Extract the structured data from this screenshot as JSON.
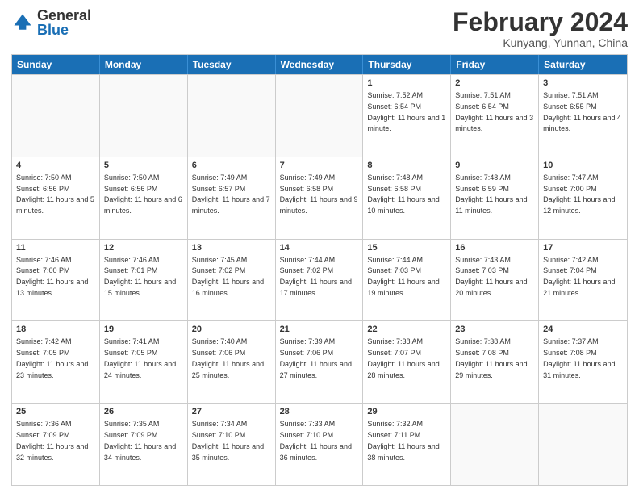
{
  "logo": {
    "general": "General",
    "blue": "Blue"
  },
  "title": "February 2024",
  "location": "Kunyang, Yunnan, China",
  "header_days": [
    "Sunday",
    "Monday",
    "Tuesday",
    "Wednesday",
    "Thursday",
    "Friday",
    "Saturday"
  ],
  "rows": [
    [
      {
        "day": "",
        "info": "",
        "empty": true
      },
      {
        "day": "",
        "info": "",
        "empty": true
      },
      {
        "day": "",
        "info": "",
        "empty": true
      },
      {
        "day": "",
        "info": "",
        "empty": true
      },
      {
        "day": "1",
        "info": "Sunrise: 7:52 AM\nSunset: 6:54 PM\nDaylight: 11 hours and 1 minute.",
        "empty": false
      },
      {
        "day": "2",
        "info": "Sunrise: 7:51 AM\nSunset: 6:54 PM\nDaylight: 11 hours and 3 minutes.",
        "empty": false
      },
      {
        "day": "3",
        "info": "Sunrise: 7:51 AM\nSunset: 6:55 PM\nDaylight: 11 hours and 4 minutes.",
        "empty": false
      }
    ],
    [
      {
        "day": "4",
        "info": "Sunrise: 7:50 AM\nSunset: 6:56 PM\nDaylight: 11 hours and 5 minutes.",
        "empty": false
      },
      {
        "day": "5",
        "info": "Sunrise: 7:50 AM\nSunset: 6:56 PM\nDaylight: 11 hours and 6 minutes.",
        "empty": false
      },
      {
        "day": "6",
        "info": "Sunrise: 7:49 AM\nSunset: 6:57 PM\nDaylight: 11 hours and 7 minutes.",
        "empty": false
      },
      {
        "day": "7",
        "info": "Sunrise: 7:49 AM\nSunset: 6:58 PM\nDaylight: 11 hours and 9 minutes.",
        "empty": false
      },
      {
        "day": "8",
        "info": "Sunrise: 7:48 AM\nSunset: 6:58 PM\nDaylight: 11 hours and 10 minutes.",
        "empty": false
      },
      {
        "day": "9",
        "info": "Sunrise: 7:48 AM\nSunset: 6:59 PM\nDaylight: 11 hours and 11 minutes.",
        "empty": false
      },
      {
        "day": "10",
        "info": "Sunrise: 7:47 AM\nSunset: 7:00 PM\nDaylight: 11 hours and 12 minutes.",
        "empty": false
      }
    ],
    [
      {
        "day": "11",
        "info": "Sunrise: 7:46 AM\nSunset: 7:00 PM\nDaylight: 11 hours and 13 minutes.",
        "empty": false
      },
      {
        "day": "12",
        "info": "Sunrise: 7:46 AM\nSunset: 7:01 PM\nDaylight: 11 hours and 15 minutes.",
        "empty": false
      },
      {
        "day": "13",
        "info": "Sunrise: 7:45 AM\nSunset: 7:02 PM\nDaylight: 11 hours and 16 minutes.",
        "empty": false
      },
      {
        "day": "14",
        "info": "Sunrise: 7:44 AM\nSunset: 7:02 PM\nDaylight: 11 hours and 17 minutes.",
        "empty": false
      },
      {
        "day": "15",
        "info": "Sunrise: 7:44 AM\nSunset: 7:03 PM\nDaylight: 11 hours and 19 minutes.",
        "empty": false
      },
      {
        "day": "16",
        "info": "Sunrise: 7:43 AM\nSunset: 7:03 PM\nDaylight: 11 hours and 20 minutes.",
        "empty": false
      },
      {
        "day": "17",
        "info": "Sunrise: 7:42 AM\nSunset: 7:04 PM\nDaylight: 11 hours and 21 minutes.",
        "empty": false
      }
    ],
    [
      {
        "day": "18",
        "info": "Sunrise: 7:42 AM\nSunset: 7:05 PM\nDaylight: 11 hours and 23 minutes.",
        "empty": false
      },
      {
        "day": "19",
        "info": "Sunrise: 7:41 AM\nSunset: 7:05 PM\nDaylight: 11 hours and 24 minutes.",
        "empty": false
      },
      {
        "day": "20",
        "info": "Sunrise: 7:40 AM\nSunset: 7:06 PM\nDaylight: 11 hours and 25 minutes.",
        "empty": false
      },
      {
        "day": "21",
        "info": "Sunrise: 7:39 AM\nSunset: 7:06 PM\nDaylight: 11 hours and 27 minutes.",
        "empty": false
      },
      {
        "day": "22",
        "info": "Sunrise: 7:38 AM\nSunset: 7:07 PM\nDaylight: 11 hours and 28 minutes.",
        "empty": false
      },
      {
        "day": "23",
        "info": "Sunrise: 7:38 AM\nSunset: 7:08 PM\nDaylight: 11 hours and 29 minutes.",
        "empty": false
      },
      {
        "day": "24",
        "info": "Sunrise: 7:37 AM\nSunset: 7:08 PM\nDaylight: 11 hours and 31 minutes.",
        "empty": false
      }
    ],
    [
      {
        "day": "25",
        "info": "Sunrise: 7:36 AM\nSunset: 7:09 PM\nDaylight: 11 hours and 32 minutes.",
        "empty": false
      },
      {
        "day": "26",
        "info": "Sunrise: 7:35 AM\nSunset: 7:09 PM\nDaylight: 11 hours and 34 minutes.",
        "empty": false
      },
      {
        "day": "27",
        "info": "Sunrise: 7:34 AM\nSunset: 7:10 PM\nDaylight: 11 hours and 35 minutes.",
        "empty": false
      },
      {
        "day": "28",
        "info": "Sunrise: 7:33 AM\nSunset: 7:10 PM\nDaylight: 11 hours and 36 minutes.",
        "empty": false
      },
      {
        "day": "29",
        "info": "Sunrise: 7:32 AM\nSunset: 7:11 PM\nDaylight: 11 hours and 38 minutes.",
        "empty": false
      },
      {
        "day": "",
        "info": "",
        "empty": true
      },
      {
        "day": "",
        "info": "",
        "empty": true
      }
    ]
  ]
}
